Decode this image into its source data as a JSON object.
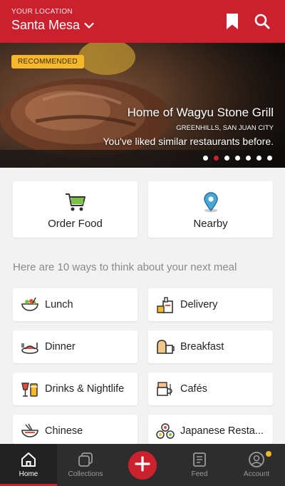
{
  "colors": {
    "brand": "#cb202d",
    "badge": "#f5b82a",
    "nav_bg": "#2d2d2d"
  },
  "header": {
    "location_label": "YOUR LOCATION",
    "location_name": "Santa Mesa",
    "icons": [
      "chevron-down-icon",
      "bookmark-icon",
      "search-icon"
    ]
  },
  "hero": {
    "badge": "RECOMMENDED",
    "title": "Home of Wagyu Stone Grill",
    "subtitle": "GREENHILLS, SAN JUAN CITY",
    "note": "You've liked similar restaurants before.",
    "slide_count": 7,
    "active_slide": 2
  },
  "quick_actions": [
    {
      "label": "Order Food",
      "icon": "shopping-cart-icon"
    },
    {
      "label": "Nearby",
      "icon": "map-pin-icon"
    }
  ],
  "section_title": "Here are 10 ways to think about your next meal",
  "categories": [
    {
      "label": "Lunch",
      "icon": "salad-bowl-icon"
    },
    {
      "label": "Delivery",
      "icon": "delivery-bag-icon"
    },
    {
      "label": "Dinner",
      "icon": "dinner-plate-icon"
    },
    {
      "label": "Breakfast",
      "icon": "toast-coffee-icon"
    },
    {
      "label": "Drinks & Nightlife",
      "icon": "cocktail-icon"
    },
    {
      "label": "Cafés",
      "icon": "coffee-cup-icon"
    },
    {
      "label": "Chinese",
      "icon": "noodle-bowl-icon"
    },
    {
      "label": "Japanese Resta...",
      "icon": "sushi-icon"
    }
  ],
  "bottom_nav": [
    {
      "label": "Home",
      "icon": "home-icon",
      "active": true
    },
    {
      "label": "Collections",
      "icon": "collections-icon",
      "active": false
    },
    {
      "label": "",
      "icon": "plus-icon",
      "active": false
    },
    {
      "label": "Feed",
      "icon": "feed-icon",
      "active": false
    },
    {
      "label": "Account",
      "icon": "account-icon",
      "active": false
    }
  ]
}
